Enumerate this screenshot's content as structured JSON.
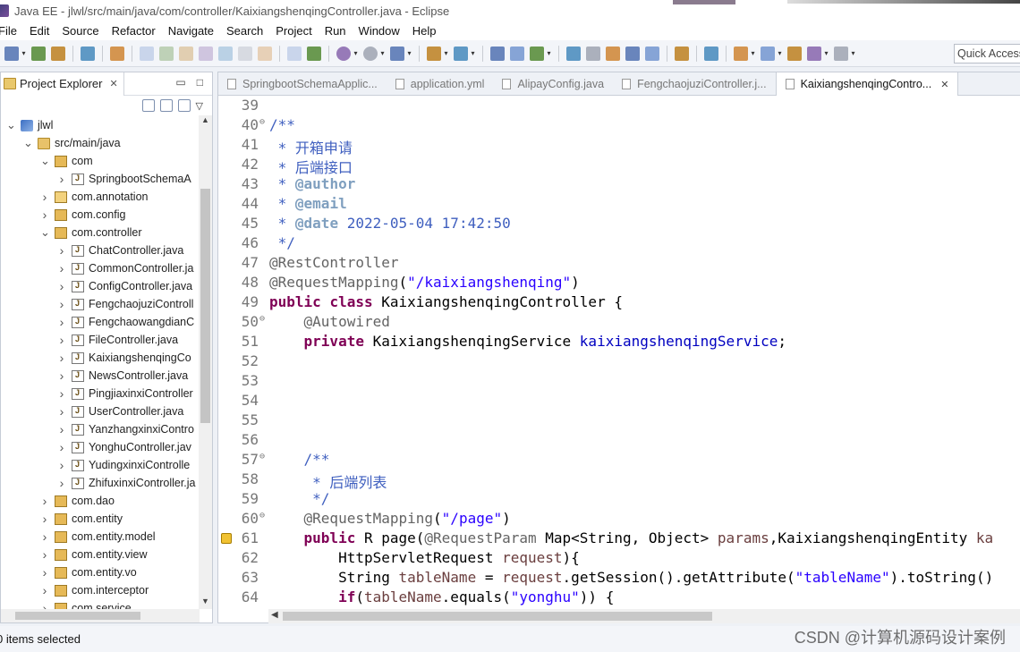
{
  "window": {
    "title": "Java EE - jlwl/src/main/java/com/controller/KaixiangshenqingController.java - Eclipse"
  },
  "menu": [
    "File",
    "Edit",
    "Source",
    "Refactor",
    "Navigate",
    "Search",
    "Project",
    "Run",
    "Window",
    "Help"
  ],
  "quick_access": {
    "placeholder": "Quick Access"
  },
  "explorer": {
    "tab_label": "Project Explorer",
    "tree": [
      {
        "label": "jlwl",
        "depth": 0,
        "twisty": "open",
        "icon": "project"
      },
      {
        "label": "src/main/java",
        "depth": 1,
        "twisty": "open",
        "icon": "srcfolder"
      },
      {
        "label": "com",
        "depth": 2,
        "twisty": "open",
        "icon": "pkg"
      },
      {
        "label": "SpringbootSchemaA",
        "depth": 3,
        "twisty": "closed",
        "icon": "java"
      },
      {
        "label": "com.annotation",
        "depth": 2,
        "twisty": "closed",
        "icon": "pkg"
      },
      {
        "label": "com.config",
        "depth": 2,
        "twisty": "closed",
        "icon": "pkg"
      },
      {
        "label": "com.controller",
        "depth": 2,
        "twisty": "open",
        "icon": "pkg"
      },
      {
        "label": "ChatController.java",
        "depth": 3,
        "twisty": "closed",
        "icon": "java"
      },
      {
        "label": "CommonController.ja",
        "depth": 3,
        "twisty": "closed",
        "icon": "java"
      },
      {
        "label": "ConfigController.java",
        "depth": 3,
        "twisty": "closed",
        "icon": "java"
      },
      {
        "label": "FengchaojuziControll",
        "depth": 3,
        "twisty": "closed",
        "icon": "java"
      },
      {
        "label": "FengchaowangdianC",
        "depth": 3,
        "twisty": "closed",
        "icon": "java"
      },
      {
        "label": "FileController.java",
        "depth": 3,
        "twisty": "closed",
        "icon": "java"
      },
      {
        "label": "KaixiangshenqingCo",
        "depth": 3,
        "twisty": "closed",
        "icon": "java"
      },
      {
        "label": "NewsController.java",
        "depth": 3,
        "twisty": "closed",
        "icon": "java"
      },
      {
        "label": "PingjiaxinxiController",
        "depth": 3,
        "twisty": "closed",
        "icon": "java"
      },
      {
        "label": "UserController.java",
        "depth": 3,
        "twisty": "closed",
        "icon": "java"
      },
      {
        "label": "YanzhangxinxiContro",
        "depth": 3,
        "twisty": "closed",
        "icon": "java"
      },
      {
        "label": "YonghuController.jav",
        "depth": 3,
        "twisty": "closed",
        "icon": "java"
      },
      {
        "label": "YudingxinxiControlle",
        "depth": 3,
        "twisty": "closed",
        "icon": "java"
      },
      {
        "label": "ZhifuxinxiController.ja",
        "depth": 3,
        "twisty": "closed",
        "icon": "java"
      },
      {
        "label": "com.dao",
        "depth": 2,
        "twisty": "closed",
        "icon": "pkg"
      },
      {
        "label": "com.entity",
        "depth": 2,
        "twisty": "closed",
        "icon": "pkg"
      },
      {
        "label": "com.entity.model",
        "depth": 2,
        "twisty": "closed",
        "icon": "pkg"
      },
      {
        "label": "com.entity.view",
        "depth": 2,
        "twisty": "closed",
        "icon": "pkg"
      },
      {
        "label": "com.entity.vo",
        "depth": 2,
        "twisty": "closed",
        "icon": "pkg"
      },
      {
        "label": "com.interceptor",
        "depth": 2,
        "twisty": "closed",
        "icon": "pkg"
      },
      {
        "label": "com.service",
        "depth": 2,
        "twisty": "closed",
        "icon": "pkg"
      }
    ]
  },
  "editor": {
    "tabs": [
      {
        "label": "SpringbootSchemaApplic...",
        "active": false
      },
      {
        "label": "application.yml",
        "active": false
      },
      {
        "label": "AlipayConfig.java",
        "active": false
      },
      {
        "label": "FengchaojuziController.j...",
        "active": false
      },
      {
        "label": "KaixiangshenqingContro...",
        "active": true
      }
    ],
    "lines": [
      {
        "n": "39",
        "fold": "",
        "segs": []
      },
      {
        "n": "40",
        "fold": "⊖",
        "segs": [
          [
            "cm",
            "/**"
          ]
        ]
      },
      {
        "n": "41",
        "fold": "",
        "segs": [
          [
            "cm",
            " * 开箱申请"
          ]
        ]
      },
      {
        "n": "42",
        "fold": "",
        "segs": [
          [
            "cm",
            " * 后端接口"
          ]
        ]
      },
      {
        "n": "43",
        "fold": "",
        "segs": [
          [
            "cm",
            " * "
          ],
          [
            "tg",
            "@author"
          ]
        ]
      },
      {
        "n": "44",
        "fold": "",
        "segs": [
          [
            "cm",
            " * "
          ],
          [
            "tg",
            "@email"
          ]
        ]
      },
      {
        "n": "45",
        "fold": "",
        "segs": [
          [
            "cm",
            " * "
          ],
          [
            "tg",
            "@date"
          ],
          [
            "cm",
            " 2022-05-04 17:42:50"
          ]
        ]
      },
      {
        "n": "46",
        "fold": "",
        "segs": [
          [
            "cm",
            " */"
          ]
        ]
      },
      {
        "n": "47",
        "fold": "",
        "segs": [
          [
            "an",
            "@RestController"
          ]
        ]
      },
      {
        "n": "48",
        "fold": "",
        "segs": [
          [
            "an",
            "@RequestMapping"
          ],
          [
            "",
            "("
          ],
          [
            "st",
            "\"/kaixiangshenqing\""
          ],
          [
            "",
            ")"
          ]
        ]
      },
      {
        "n": "49",
        "fold": "",
        "segs": [
          [
            "kw",
            "public"
          ],
          [
            "",
            " "
          ],
          [
            "kw",
            "class"
          ],
          [
            "",
            " KaixiangshenqingController {"
          ]
        ]
      },
      {
        "n": "50",
        "fold": "⊖",
        "segs": [
          [
            "",
            "    "
          ],
          [
            "an",
            "@Autowired"
          ]
        ]
      },
      {
        "n": "51",
        "fold": "",
        "segs": [
          [
            "",
            "    "
          ],
          [
            "kw",
            "private"
          ],
          [
            "",
            " KaixiangshenqingService "
          ],
          [
            "fd",
            "kaixiangshenqingService"
          ],
          [
            "",
            ";"
          ]
        ]
      },
      {
        "n": "52",
        "fold": "",
        "segs": []
      },
      {
        "n": "53",
        "fold": "",
        "segs": []
      },
      {
        "n": "54",
        "fold": "",
        "segs": []
      },
      {
        "n": "55",
        "fold": "",
        "segs": []
      },
      {
        "n": "56",
        "fold": "",
        "segs": []
      },
      {
        "n": "57",
        "fold": "⊖",
        "segs": [
          [
            "cm",
            "    /**"
          ]
        ]
      },
      {
        "n": "58",
        "fold": "",
        "segs": [
          [
            "cm",
            "     * 后端列表"
          ]
        ]
      },
      {
        "n": "59",
        "fold": "",
        "segs": [
          [
            "cm",
            "     */"
          ]
        ]
      },
      {
        "n": "60",
        "fold": "⊖",
        "segs": [
          [
            "",
            "    "
          ],
          [
            "an",
            "@RequestMapping"
          ],
          [
            "",
            "("
          ],
          [
            "st",
            "\"/page\""
          ],
          [
            "",
            ")"
          ]
        ]
      },
      {
        "n": "61",
        "fold": "",
        "marker": true,
        "segs": [
          [
            "",
            "    "
          ],
          [
            "kw",
            "public"
          ],
          [
            "",
            " R page("
          ],
          [
            "an",
            "@RequestParam"
          ],
          [
            "",
            " Map<String, Object> "
          ],
          [
            "vr",
            "params"
          ],
          [
            "",
            ",KaixiangshenqingEntity "
          ],
          [
            "vr",
            "ka"
          ]
        ]
      },
      {
        "n": "62",
        "fold": "",
        "segs": [
          [
            "",
            "        HttpServletRequest "
          ],
          [
            "vr",
            "request"
          ],
          [
            "",
            "){"
          ]
        ]
      },
      {
        "n": "63",
        "fold": "",
        "segs": [
          [
            "",
            "        String "
          ],
          [
            "vr",
            "tableName"
          ],
          [
            "",
            " = "
          ],
          [
            "vr",
            "request"
          ],
          [
            "",
            ".getSession().getAttribute("
          ],
          [
            "st",
            "\"tableName\""
          ],
          [
            "",
            ").toString()"
          ]
        ]
      },
      {
        "n": "64",
        "fold": "",
        "segs": [
          [
            "",
            "        "
          ],
          [
            "kw",
            "if"
          ],
          [
            "",
            "("
          ],
          [
            "vr",
            "tableName"
          ],
          [
            "",
            ".equals("
          ],
          [
            "st",
            "\"yonghu\""
          ],
          [
            "",
            ")) {"
          ]
        ]
      }
    ]
  },
  "status": {
    "text": "0 items selected"
  },
  "watermark": "CSDN @计算机源码设计案例",
  "colors": {
    "keyword": "#7f0055",
    "comment": "#3f5fbf",
    "string": "#2a00ff",
    "annotation": "#646464",
    "field": "#0000c0"
  }
}
